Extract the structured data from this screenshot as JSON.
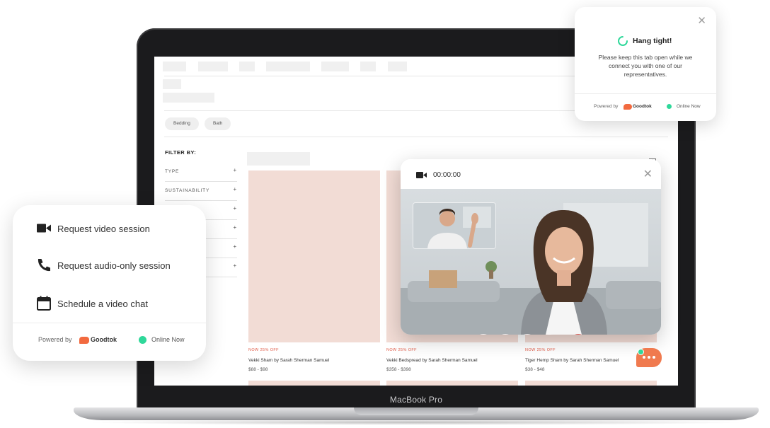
{
  "shop": {
    "chips": [
      "Bedding",
      "Bath"
    ],
    "filter_title": "FILTER BY:",
    "filters": [
      "TYPE",
      "SUSTAINABILITY",
      "",
      "",
      "",
      ""
    ],
    "products": [
      {
        "sale": "NOW 25% OFF",
        "name": "Vekki Sham by Sarah Sherman Samuel",
        "price": "$88 - $98"
      },
      {
        "sale": "NOW 25% OFF",
        "name": "Vekki Bedspread by Sarah Sherman Samuel",
        "price": "$358 - $398"
      },
      {
        "sale": "NOW 25% OFF",
        "name": "Tiger Hemp Sham by Sarah Sherman Samuel",
        "price": "$38 - $48"
      }
    ]
  },
  "laptop": {
    "label": "MacBook Pro"
  },
  "video_call": {
    "timer": "00:00:00",
    "icons": [
      "video-camera-icon",
      "close-icon",
      "mic-icon",
      "camera-icon",
      "pip-icon",
      "screen-share-icon",
      "end-call-icon"
    ]
  },
  "hang_tight": {
    "title": "Hang tight!",
    "message": "Please keep this tab open while we connect you with one of our representatives.",
    "powered_by": "Powered by",
    "brand": "Goodtok",
    "status": "Online Now"
  },
  "options": {
    "items": [
      {
        "label": "Request video session",
        "icon": "video-camera-icon"
      },
      {
        "label": "Request audio-only session",
        "icon": "phone-icon"
      },
      {
        "label": "Schedule a video chat",
        "icon": "calendar-icon"
      }
    ],
    "powered_by": "Powered by",
    "brand": "Goodtok",
    "status": "Online Now"
  },
  "colors": {
    "brand_orange": "#f26a3f",
    "online_green": "#2fd89a",
    "product_pink": "#f2dcd5",
    "end_call_red": "#d9534f"
  }
}
